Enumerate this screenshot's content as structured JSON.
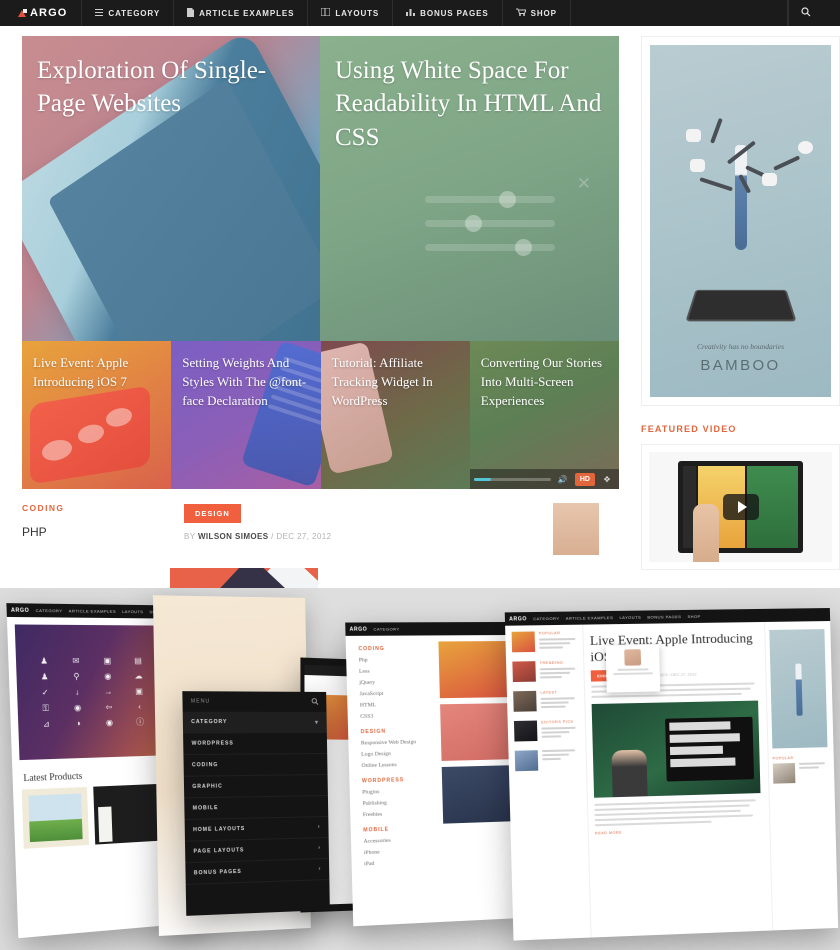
{
  "navbar": {
    "logo": "ARGO",
    "logo_icon": "argo-flag-icon",
    "items": [
      {
        "label": "CATEGORY",
        "icon": "hamburger-icon"
      },
      {
        "label": "ARTICLE EXAMPLES",
        "icon": "document-icon"
      },
      {
        "label": "LAYOUTS",
        "icon": "columns-icon"
      },
      {
        "label": "BONUS PAGES",
        "icon": "bar-chart-icon"
      },
      {
        "label": "SHOP",
        "icon": "cart-icon"
      }
    ],
    "search_icon": "search-icon"
  },
  "hero": {
    "featured": [
      {
        "title": "Exploration Of Single-Page Websites"
      },
      {
        "title": "Using White Space For Readability In HTML And CSS"
      }
    ],
    "tiles": [
      {
        "title": "Live Event: Apple Introducing iOS 7"
      },
      {
        "title": "Setting Weights And Styles With The @font-face Declaration"
      },
      {
        "title": "Tutorial: Affiliate Tracking Widget In WordPress"
      },
      {
        "title": "Converting Our Stories Into Multi-Screen Experiences"
      }
    ],
    "video_controls": {
      "hd_badge": "HD",
      "volume_icon": "speaker-icon",
      "fullscreen_icon": "expand-icon"
    }
  },
  "sidebar": {
    "ad": {
      "tagline": "Creativity has no boundaries",
      "brand": "BAMBOO"
    },
    "featured_video": {
      "heading": "FEATURED VIDEO",
      "play_icon": "play-icon"
    }
  },
  "lower_strip": {
    "category": "CODING",
    "subcategory": "PHP",
    "badge": "DESIGN",
    "byline_prefix": "BY",
    "author": "WILSON SIMOES",
    "byline_sep": "/",
    "date": "DEC 27, 2012"
  },
  "showcase": {
    "mock_desktop": {
      "logo": "ARGO",
      "nav": [
        "CATEGORY",
        "ARTICLE EXAMPLES",
        "LAYOUTS",
        "SHOP"
      ],
      "heading": "Latest Products",
      "icon_glyphs": [
        "♟",
        "✉",
        "❐",
        "☷",
        "✎",
        "☹",
        "⚲",
        "⚑",
        "☁",
        "❦",
        "✓",
        "↓",
        "→",
        "❑",
        "▣",
        "⚿",
        "◉",
        "⌥",
        "‹",
        "⌘",
        "⊿",
        "◑",
        "◉",
        "ⓘ",
        "✕"
      ]
    },
    "mock_menu": {
      "header": "MENU",
      "search_icon": "search-icon",
      "items": [
        {
          "label": "CATEGORY",
          "chevron": "chevron-down-icon"
        },
        {
          "label": "WORDPRESS",
          "chevron": ""
        },
        {
          "label": "CODING",
          "chevron": ""
        },
        {
          "label": "GRAPHIC",
          "chevron": ""
        },
        {
          "label": "MOBILE",
          "chevron": ""
        },
        {
          "label": "HOME LAYOUTS",
          "chevron": "chevron-right-icon"
        },
        {
          "label": "PAGE LAYOUTS",
          "chevron": "chevron-right-icon"
        },
        {
          "label": "BONUS PAGES",
          "chevron": "chevron-right-icon"
        }
      ]
    },
    "mock_sitemap": {
      "groups": [
        {
          "heading": "CODING",
          "links": [
            "Php",
            "Less",
            "jQuery",
            "JavaScript",
            "HTML",
            "CSS3"
          ]
        },
        {
          "heading": "DESIGN",
          "links": [
            "Responsive Web Design",
            "Logo Design",
            "Online Lessons"
          ]
        },
        {
          "heading": "WORDPRESS",
          "links": [
            "Plugins",
            "Publishing",
            "Freebies"
          ]
        },
        {
          "heading": "MOBILE",
          "links": [
            "Accessories",
            "iPhone",
            "iPad"
          ]
        }
      ]
    },
    "mock_article": {
      "logo": "ARGO",
      "nav": [
        "CATEGORY",
        "ARTICLE EXAMPLES",
        "LAYOUTS",
        "BONUS PAGES",
        "SHOP"
      ],
      "title": "Live Event: Apple Introducing iOS 7",
      "badge": "EVENT",
      "meta": "BY WILSON SIMOES / DEC 27, 2012",
      "sidebar_categories": [
        "POPULAR",
        "TRENDING",
        "LATEST",
        "EDITORS PICK"
      ],
      "read_more": "READ MORE"
    },
    "mock_tablet": {
      "menu_icon": "hamburger-icon"
    }
  }
}
